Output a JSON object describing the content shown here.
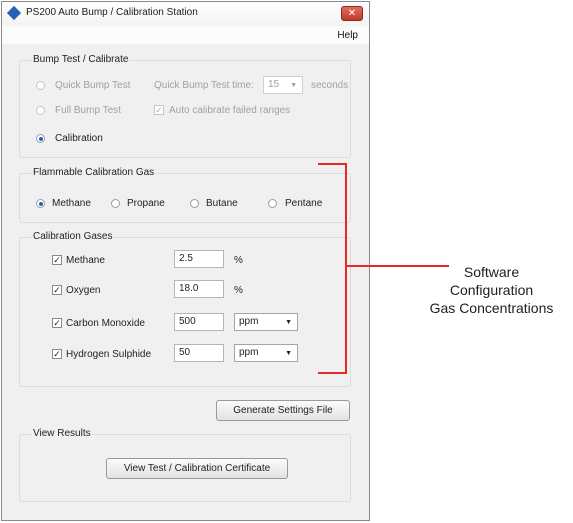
{
  "window": {
    "title": "PS200 Auto Bump / Calibration Station",
    "close_glyph": "✕"
  },
  "menu": {
    "help": "Help"
  },
  "bump": {
    "group_title": "Bump Test / Calibrate",
    "quick_bump": "Quick Bump Test",
    "quick_time_label": "Quick Bump Test time:",
    "quick_time_value": "15",
    "seconds": "seconds",
    "full_bump": "Full Bump Test",
    "auto_calibrate": "Auto calibrate failed ranges",
    "calibration": "Calibration",
    "selected": "Calibration"
  },
  "flammable": {
    "group_title": "Flammable Calibration Gas",
    "options": [
      "Methane",
      "Propane",
      "Butane",
      "Pentane"
    ],
    "selected": "Methane"
  },
  "gases": {
    "group_title": "Calibration Gases",
    "rows": [
      {
        "name": "Methane",
        "checked": true,
        "value": "2.5",
        "unit": "%"
      },
      {
        "name": "Oxygen",
        "checked": true,
        "value": "18.0",
        "unit": "%"
      },
      {
        "name": "Carbon Monoxide",
        "checked": true,
        "value": "500",
        "unit": "ppm"
      },
      {
        "name": "Hydrogen Sulphide",
        "checked": true,
        "value": "50",
        "unit": "ppm"
      }
    ]
  },
  "generate_button": "Generate Settings File",
  "results": {
    "group_title": "View Results",
    "certificate_button": "View Test / Calibration Certificate"
  },
  "annotation": {
    "line1": "Software",
    "line2": "Configuration",
    "line3": "Gas Concentrations",
    "color": "#e22a2a"
  }
}
